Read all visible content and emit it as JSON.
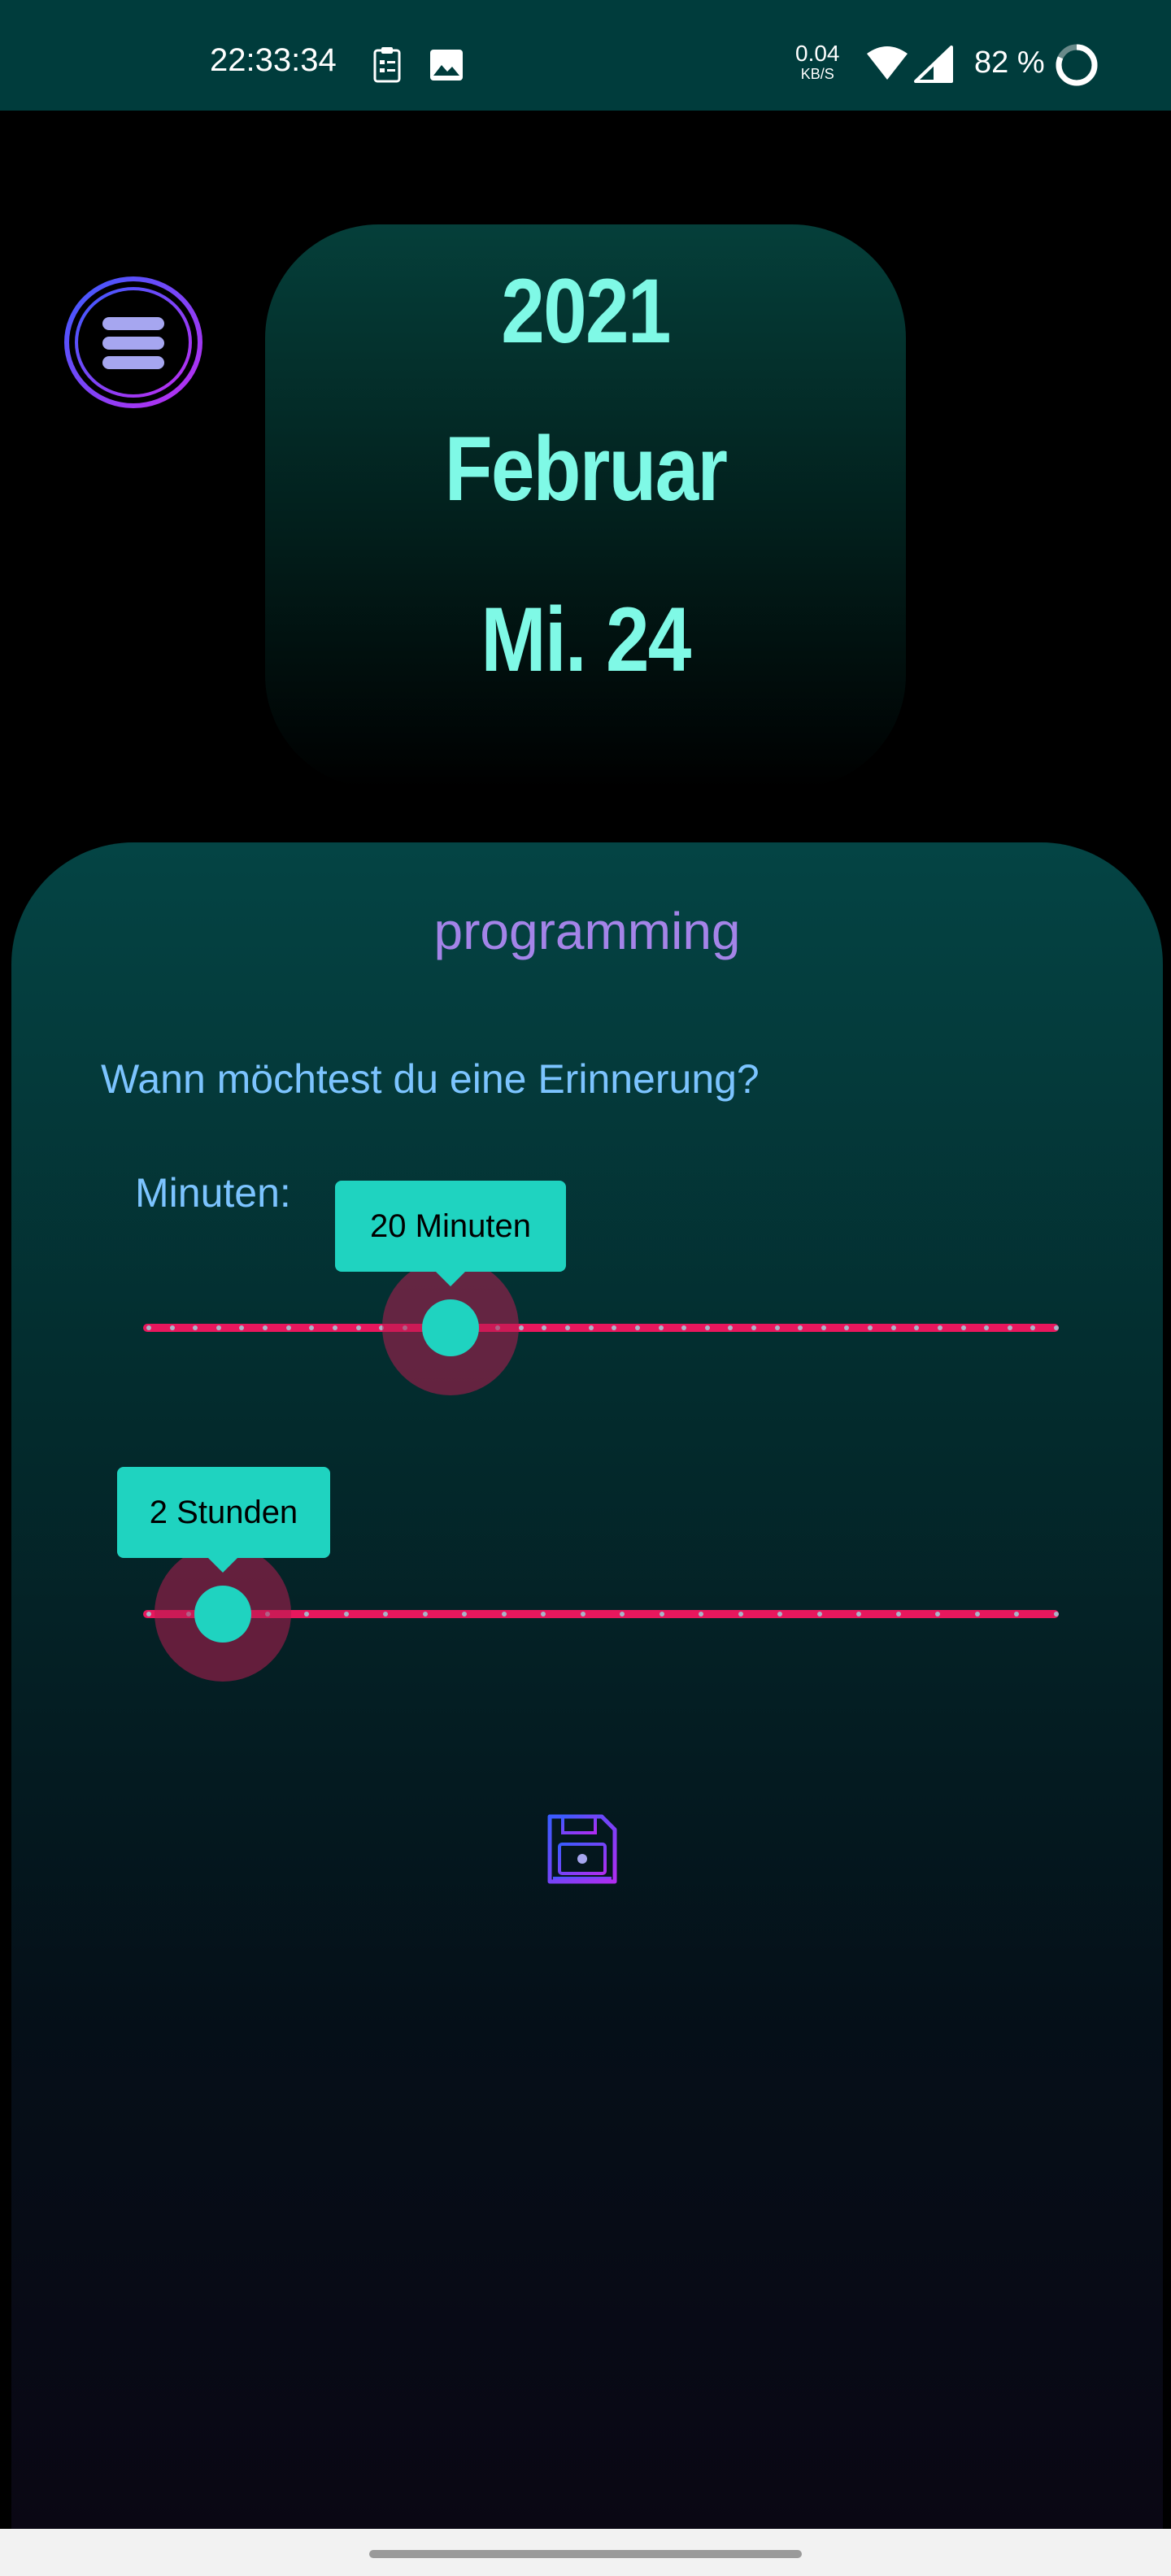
{
  "status_bar": {
    "time": "22:33:34",
    "speed_value": "0.04",
    "speed_unit": "KB/S",
    "battery": "82 %",
    "icons": [
      "clipboard-icon",
      "image-icon",
      "wifi-icon",
      "signal-icon",
      "battery-ring-icon"
    ]
  },
  "date_card": {
    "year": "2021",
    "month": "Februar",
    "day": "Mi. 24"
  },
  "panel": {
    "title": "programming",
    "question": "Wann möchtest du eine Erinnerung?",
    "minutes_label": "Minuten:"
  },
  "sliders": {
    "minutes": {
      "tooltip": "20 Minuten",
      "value_fraction": 0.33
    },
    "hours": {
      "tooltip": "2 Stunden",
      "value_fraction": 0.08
    }
  },
  "colors": {
    "accent": "#1fd3c0",
    "track": "#e8175d",
    "title": "#a484e8",
    "text": "#7cc4ff",
    "date": "#7ff9e6"
  },
  "icons": {
    "menu": "menu-icon",
    "save": "save-icon"
  }
}
